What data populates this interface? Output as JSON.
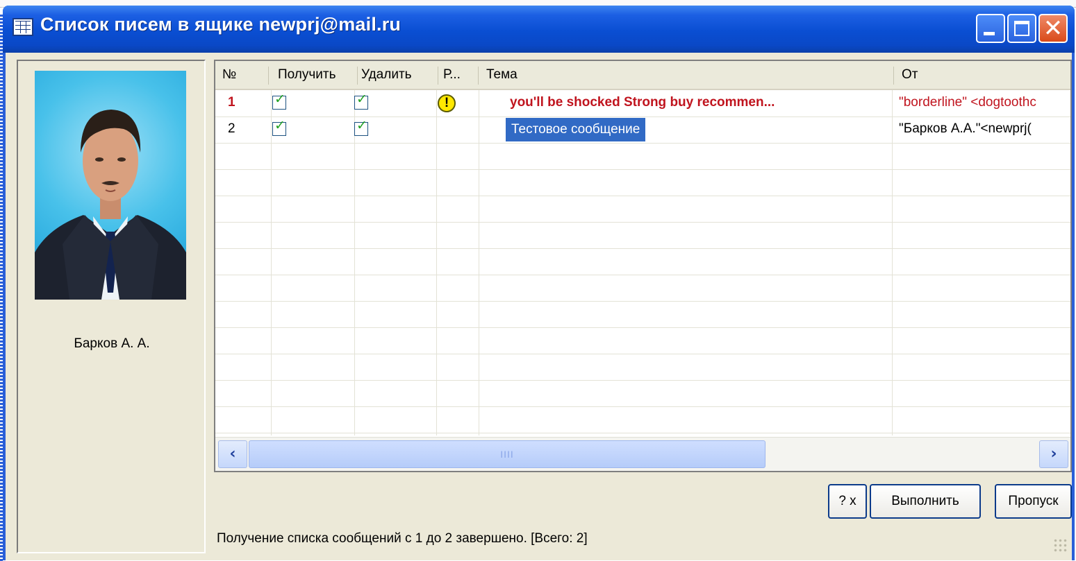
{
  "window": {
    "title": "Список писем в ящике newprj@mail.ru",
    "controls": {
      "minimize": "minimize",
      "maximize": "maximize",
      "close": "close"
    }
  },
  "sidebar": {
    "photo": "portrait-photo",
    "name": "Барков А. А."
  },
  "table": {
    "columns": [
      "№",
      "Получить",
      "Удалить",
      "Р...",
      "Тема",
      "От"
    ],
    "rows": [
      {
        "num": "1",
        "receive": true,
        "delete": true,
        "priority": "!",
        "subject": "you'll be shocked Strong buy recommen...",
        "from": "\"borderline\" <dogtoothc",
        "style": "unread-high-priority",
        "color": "#c0141e"
      },
      {
        "num": "2",
        "receive": true,
        "delete": true,
        "priority": "",
        "subject": "Тестовое сообщение",
        "from": "\"Барков А.А.\"<newprj(",
        "style": "selected"
      }
    ],
    "scrollbar_grip": "IIII"
  },
  "buttons": {
    "help": "? x",
    "execute": "Выполнить",
    "skip": "Пропуск"
  },
  "status": {
    "text": "Получение списка сообщений с 1 до 2 завершено. [Всего: 2]"
  },
  "colors": {
    "titlebar": "#0a4ed2",
    "face": "#ece9d8",
    "selection": "#316ac5",
    "highlight_text": "#c0141e"
  }
}
